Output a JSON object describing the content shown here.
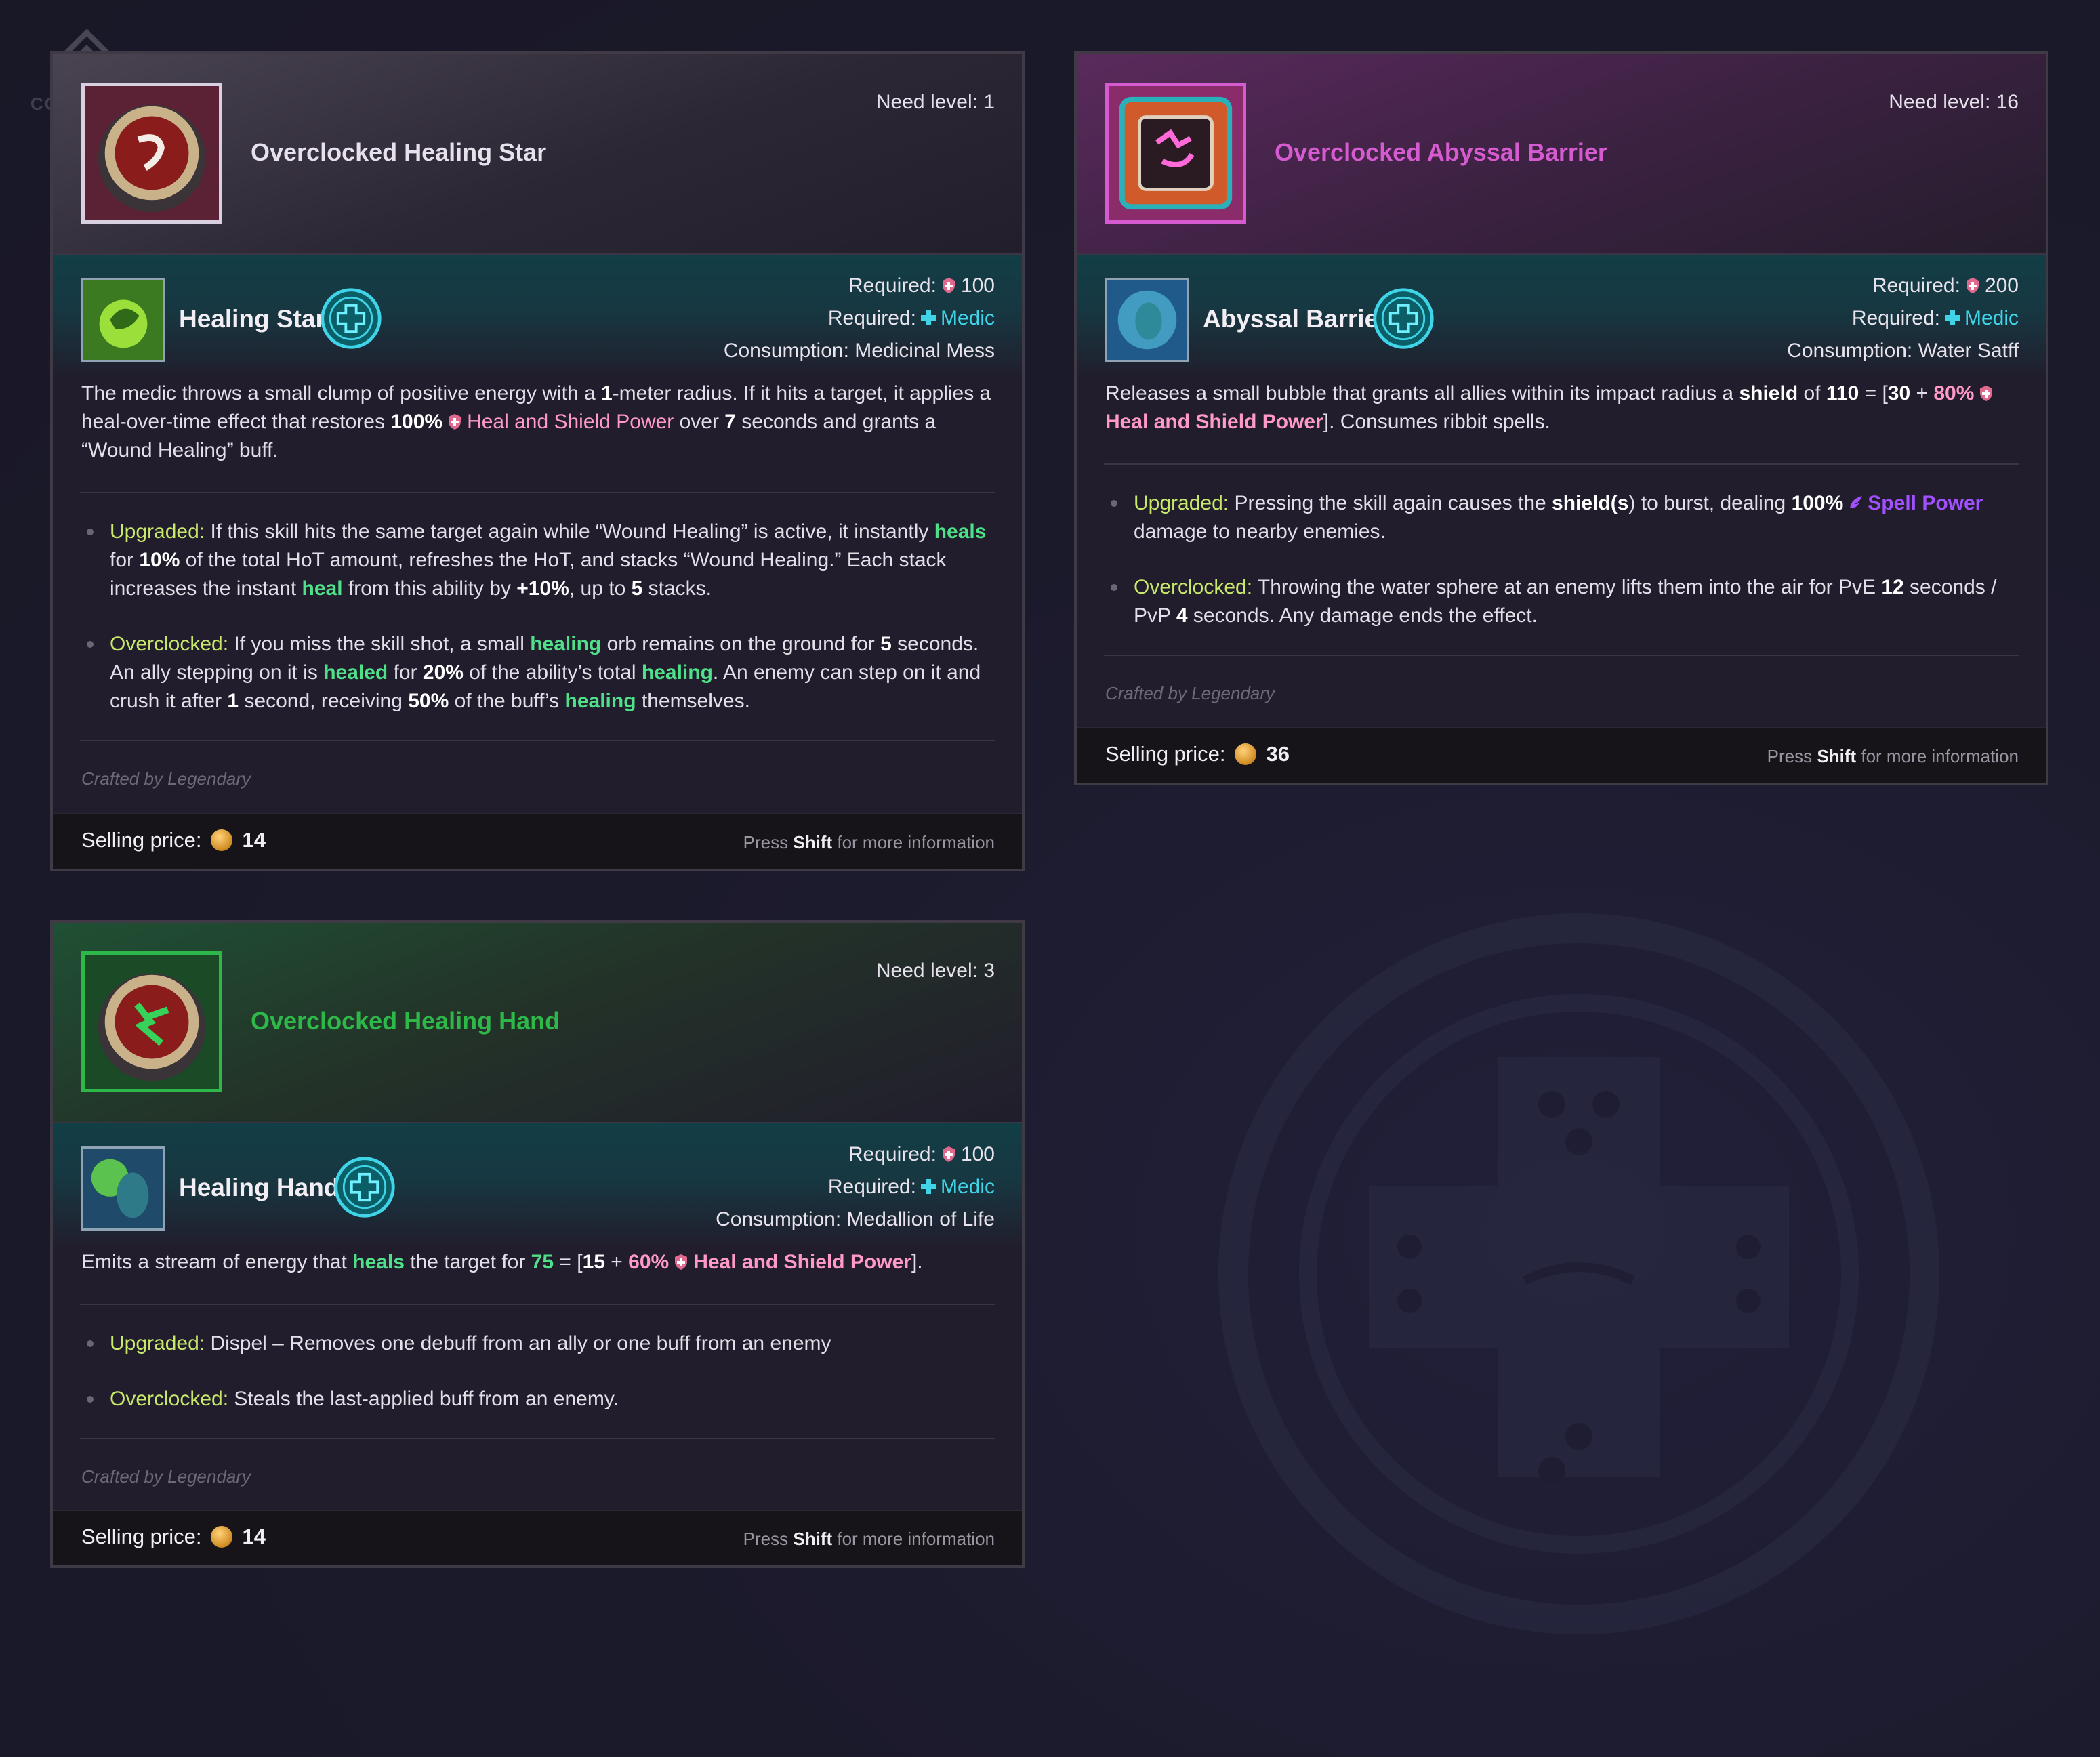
{
  "watermark": {
    "text": "COREDUNK"
  },
  "colors": {
    "grey_title": "#e6e1ea",
    "pink_title": "#d65bd0",
    "green_title": "#2fb84a",
    "medic": "#3fd4e8",
    "keyword_green": "#4fe08a",
    "label_lime": "#c8e86a"
  },
  "cards": {
    "healing_star": {
      "item_name": "Overclocked Healing Star",
      "need_level": "Need level: 1",
      "skill_name": "Healing Star",
      "req_power_label": "Required:",
      "req_power_value": "100",
      "req_class_label": "Required:",
      "req_class_value": "Medic",
      "consumption": "Consumption: Medicinal Mess",
      "desc": [
        "The medic throws a small clump of positive energy with a ",
        "1",
        "-meter radius. If it hits a target, it applies a heal-over-time effect that restores ",
        "100%",
        "Heal and Shield Power",
        " over ",
        "7",
        " seconds and grants a “Wound Healing” buff."
      ],
      "upgraded_label": "Upgraded:",
      "upgraded": [
        " If this skill hits the same target again while “Wound Healing” is active, it instantly ",
        "heals",
        " for ",
        "10%",
        " of the total HoT amount, refreshes the HoT, and stacks “Wound Healing.” Each stack increases the instant ",
        "heal",
        " from this ability by ",
        "+10%",
        ", up to ",
        "5",
        " stacks."
      ],
      "overclocked_label": "Overclocked:",
      "overclocked": [
        " If you miss the skill shot, a small ",
        "healing",
        " orb remains on the ground for ",
        "5",
        " seconds. An ally stepping on it is ",
        "healed",
        " for ",
        "20%",
        " of the ability’s total ",
        "healing",
        ". An enemy can step on it and crush it after ",
        "1",
        " second, receiving ",
        "50%",
        " of the buff’s ",
        "healing",
        " themselves."
      ],
      "crafted": "Crafted by Legendary",
      "sell_label": "Selling price:",
      "price": "14",
      "shift_pre": "Press ",
      "shift_key": "Shift",
      "shift_post": " for more information"
    },
    "abyssal_barrier": {
      "item_name": "Overclocked Abyssal Barrier",
      "need_level": "Need level: 16",
      "skill_name": "Abyssal Barrier",
      "req_power_label": "Required:",
      "req_power_value": "200",
      "req_class_label": "Required:",
      "req_class_value": "Medic",
      "consumption": "Consumption: Water Satff",
      "desc": [
        "Releases a small bubble that grants all allies within its impact radius a ",
        "shield",
        " of ",
        "110",
        " = [",
        "30",
        " + ",
        "80%",
        "Heal and Shield Power",
        "]. Consumes ribbit spells."
      ],
      "upgraded_label": "Upgraded:",
      "upgraded": [
        " Pressing the skill again causes the ",
        "shield(s",
        ") to burst, dealing ",
        "100%",
        "Spell Power",
        " damage to nearby enemies."
      ],
      "overclocked_label": "Overclocked:",
      "overclocked": [
        " Throwing the water sphere at an enemy lifts them into the air for PvE ",
        "12",
        " seconds / PvP ",
        "4",
        " seconds. Any damage ends the effect."
      ],
      "crafted": "Crafted by Legendary",
      "sell_label": "Selling price:",
      "price": "36",
      "shift_pre": "Press ",
      "shift_key": "Shift",
      "shift_post": " for more information"
    },
    "healing_hand": {
      "item_name": "Overclocked Healing Hand",
      "need_level": "Need level: 3",
      "skill_name": "Healing Hand",
      "req_power_label": "Required:",
      "req_power_value": "100",
      "req_class_label": "Required:",
      "req_class_value": "Medic",
      "consumption": "Consumption: Medallion of Life",
      "desc": [
        "Emits a stream of energy that ",
        "heals",
        " the target for ",
        "75",
        " = [",
        "15",
        " + ",
        "60%",
        "Heal and Shield Power",
        "]."
      ],
      "upgraded_label": "Upgraded:",
      "upgraded": [
        " Dispel – Removes one debuff from an ally or one buff from an enemy"
      ],
      "overclocked_label": "Overclocked:",
      "overclocked": [
        " Steals the last-applied buff from an enemy."
      ],
      "crafted": "Crafted by Legendary",
      "sell_label": "Selling price:",
      "price": "14",
      "shift_pre": "Press ",
      "shift_key": "Shift",
      "shift_post": " for more information"
    }
  }
}
